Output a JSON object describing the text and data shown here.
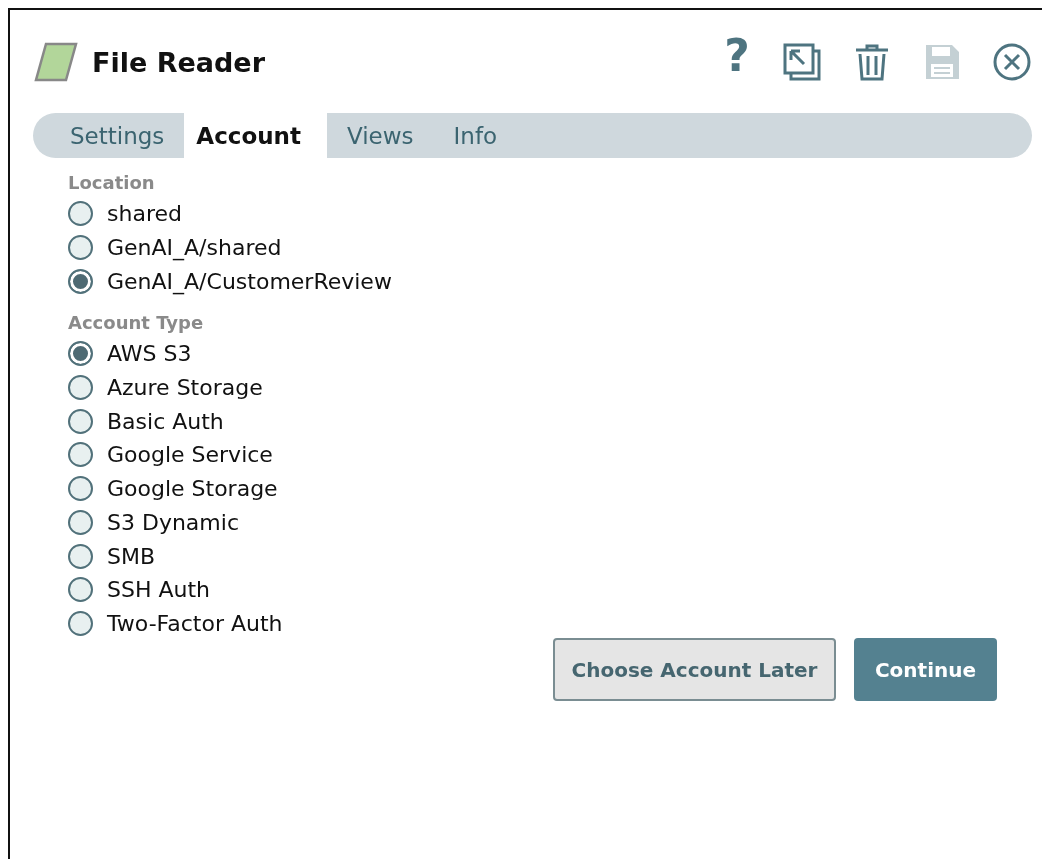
{
  "window": {
    "title": "File Reader"
  },
  "toolbar": [
    {
      "kind": "help",
      "text": "?",
      "disabled": false
    },
    {
      "kind": "window",
      "disabled": false
    },
    {
      "kind": "trash",
      "disabled": false
    },
    {
      "kind": "save",
      "disabled": true
    },
    {
      "kind": "close",
      "disabled": false
    }
  ],
  "tabs": [
    {
      "label": "Settings",
      "selected": false
    },
    {
      "label": "Account",
      "selected": true
    },
    {
      "label": "Views",
      "selected": false
    },
    {
      "label": "Info",
      "selected": false
    }
  ],
  "groups": [
    {
      "label": "Location",
      "options": [
        {
          "label": "shared",
          "selected": false
        },
        {
          "label": "GenAI_A/shared",
          "selected": false
        },
        {
          "label": "GenAI_A/CustomerReview",
          "selected": true
        }
      ]
    },
    {
      "label": "Account Type",
      "options": [
        {
          "label": "AWS S3",
          "selected": true
        },
        {
          "label": "Azure Storage",
          "selected": false
        },
        {
          "label": "Basic Auth",
          "selected": false
        },
        {
          "label": "Google Service",
          "selected": false
        },
        {
          "label": "Google Storage",
          "selected": false
        },
        {
          "label": "S3 Dynamic",
          "selected": false
        },
        {
          "label": "SMB",
          "selected": false
        },
        {
          "label": "SSH Auth",
          "selected": false
        },
        {
          "label": "Two-Factor Auth",
          "selected": false
        }
      ]
    }
  ],
  "buttons": [
    {
      "label": "Choose Account Later",
      "kind": "secondary"
    },
    {
      "label": "Continue",
      "kind": "primary"
    }
  ]
}
